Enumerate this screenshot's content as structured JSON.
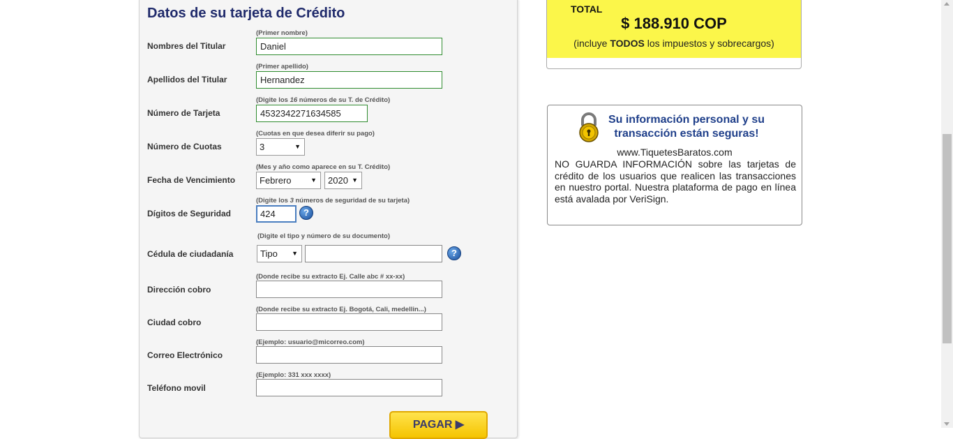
{
  "form": {
    "title": "Datos de su tarjeta de Crédito",
    "nombres": {
      "label": "Nombres del Titular",
      "hint": "(Primer nombre)",
      "value": "Daniel"
    },
    "apellidos": {
      "label": "Apellidos del Titular",
      "hint": "(Primer apellido)",
      "value": "Hernandez"
    },
    "tarjeta": {
      "label": "Número de Tarjeta",
      "hint_a": "(Digite los ",
      "hint_b": "16",
      "hint_c": " números de su T. de Crédito)",
      "value": "4532342271634585"
    },
    "cuotas": {
      "label": "Número de Cuotas",
      "hint": "(Cuotas en que desea diferir su pago)",
      "value": "3"
    },
    "vencimiento": {
      "label": "Fecha de Vencimiento",
      "hint": "(Mes y año como aparece en su T. Crédito)",
      "month": "Febrero",
      "year": "2020"
    },
    "seguridad": {
      "label": "Dígitos de Seguridad",
      "hint_a": "(Digite los ",
      "hint_b": "3",
      "hint_c": " números de seguridad de su tarjeta)",
      "value": "424"
    },
    "cedula": {
      "label": "Cédula de ciudadanía",
      "hint": "(Digite el tipo y número de su documento)",
      "tipo": "Tipo",
      "numero": ""
    },
    "direccion": {
      "label": "Dirección cobro",
      "hint": "(Donde recibe su extracto Ej. Calle abc # xx-xx)",
      "value": ""
    },
    "ciudad": {
      "label": "Ciudad cobro",
      "hint": "(Donde recibe su extracto Ej. Bogotá, Cali, medellin...)",
      "value": ""
    },
    "correo": {
      "label": "Correo Electrónico",
      "hint": "(Ejemplo: usuario@micorreo.com)",
      "value": ""
    },
    "telefono": {
      "label": "Teléfono movil",
      "hint": "(Ejemplo: 331 xxx xxxx)",
      "value": ""
    },
    "pay_button": "PAGAR ▶",
    "help_glyph": "?"
  },
  "total": {
    "label": "TOTAL",
    "amount": "$ 188.910 COP",
    "note_a": "(incluye ",
    "note_b": "TODOS",
    "note_c": " los impuestos y sobrecargos)"
  },
  "secure": {
    "title": "Su información personal y su transacción están seguras!",
    "site": "www.TiquetesBaratos.com",
    "body": "NO GUARDA INFORMACIÓN sobre las tarjetas de crédito de los usuarios que realicen las transacciones en nuestro portal. Nuestra plataforma de pago en línea está avalada por VeriSign."
  },
  "icons": {
    "lock": "padlock-icon",
    "help": "question-icon",
    "dropdown": "chevron-down-icon"
  },
  "colors": {
    "title": "#1f2a6b",
    "total_bg": "#fbf64a",
    "valid_border": "#2e8b2e",
    "focus_border": "#4a7ec0",
    "button": "#f5c400"
  }
}
